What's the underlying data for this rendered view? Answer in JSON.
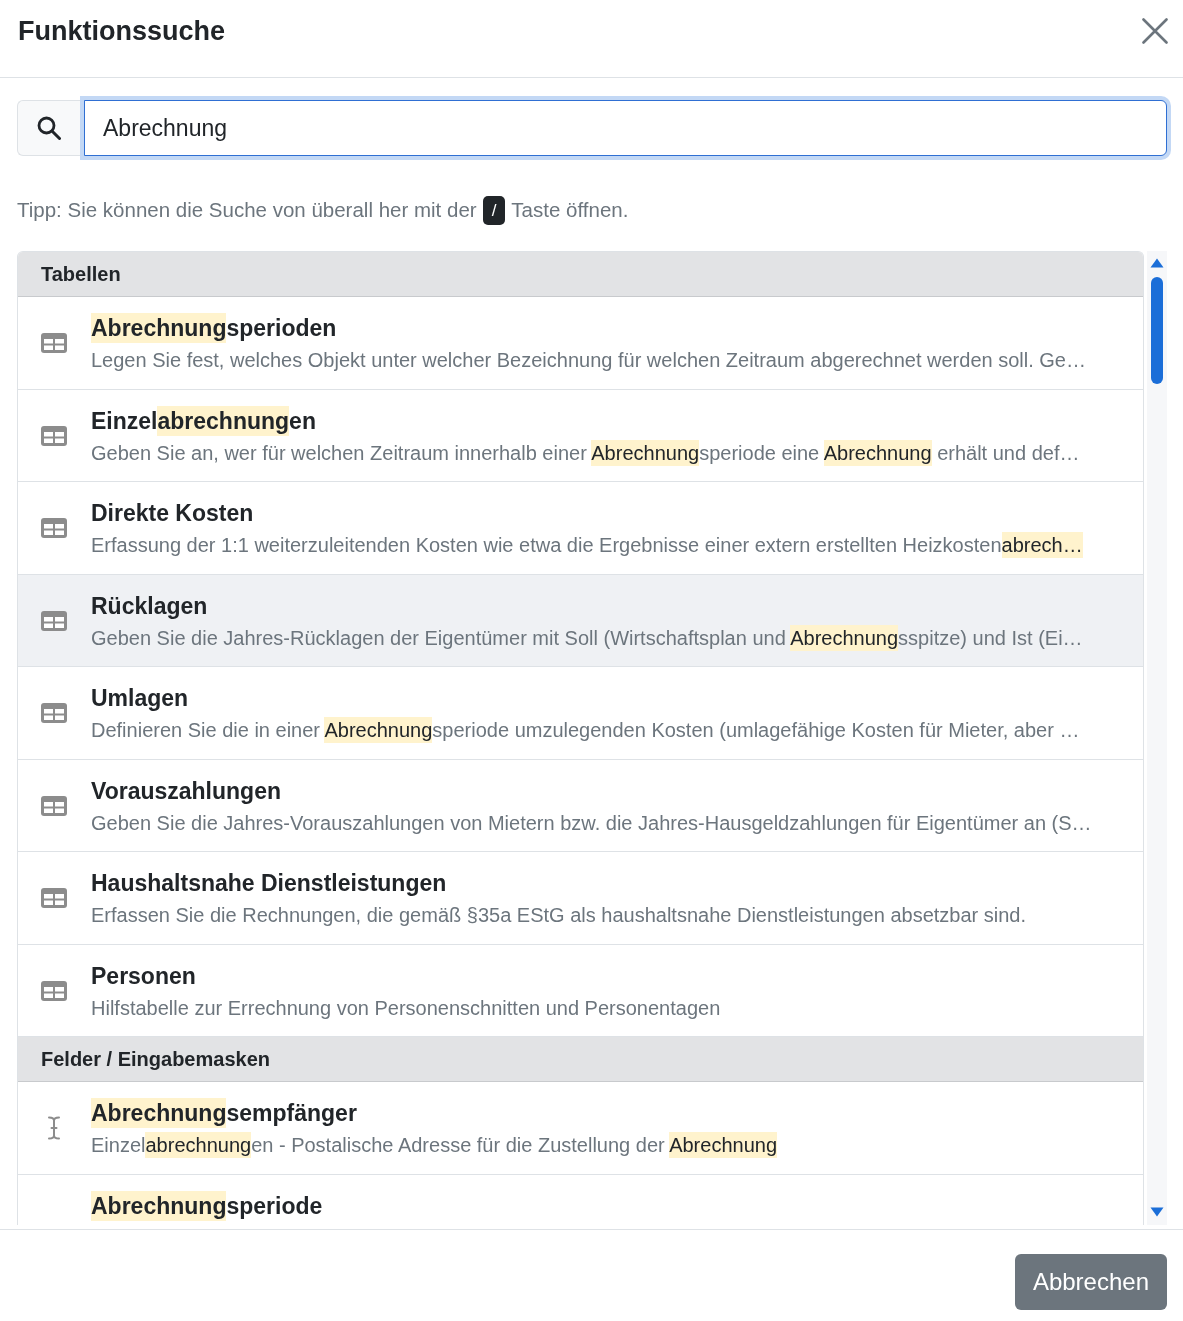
{
  "dialog": {
    "title": "Funktionssuche"
  },
  "search": {
    "value": "Abrechnung",
    "focused": true
  },
  "tip": {
    "before": "Tipp: Sie können die Suche von überall her mit der",
    "key": "/",
    "after": "Taste öffnen."
  },
  "groups": [
    {
      "label": "Tabellen",
      "items": [
        {
          "kind": "table",
          "selected": false,
          "title": [
            {
              "text": "Abrechnung",
              "highlight": true
            },
            {
              "text": "sperioden",
              "highlight": false
            }
          ],
          "description": [
            {
              "text": "Legen Sie fest, welches Objekt unter welcher Bezeichnung für welchen Zeitraum abgerechnet werden soll. Ge…",
              "highlight": false
            }
          ]
        },
        {
          "kind": "table",
          "selected": false,
          "title": [
            {
              "text": "Einzel",
              "highlight": false
            },
            {
              "text": "abrechnung",
              "highlight": true
            },
            {
              "text": "en",
              "highlight": false
            }
          ],
          "description": [
            {
              "text": "Geben Sie an, wer für welchen Zeitraum innerhalb einer ",
              "highlight": false
            },
            {
              "text": "Abrechnung",
              "highlight": true
            },
            {
              "text": "speriode eine ",
              "highlight": false
            },
            {
              "text": "Abrechnung",
              "highlight": true
            },
            {
              "text": " erhält und def…",
              "highlight": false
            }
          ]
        },
        {
          "kind": "table",
          "selected": false,
          "title": [
            {
              "text": "Direkte Kosten",
              "highlight": false
            }
          ],
          "description": [
            {
              "text": "Erfassung der 1:1 weiterzuleitenden Kosten wie etwa die Ergebnisse einer extern erstellten Heizkosten",
              "highlight": false
            },
            {
              "text": "abrech…",
              "highlight": true
            }
          ]
        },
        {
          "kind": "table",
          "selected": true,
          "title": [
            {
              "text": "Rücklagen",
              "highlight": false
            }
          ],
          "description": [
            {
              "text": "Geben Sie die Jahres-Rücklagen der Eigentümer mit Soll (Wirtschaftsplan und ",
              "highlight": false
            },
            {
              "text": "Abrechnung",
              "highlight": true
            },
            {
              "text": "sspitze) und Ist (Ei…",
              "highlight": false
            }
          ]
        },
        {
          "kind": "table",
          "selected": false,
          "title": [
            {
              "text": "Umlagen",
              "highlight": false
            }
          ],
          "description": [
            {
              "text": "Definieren Sie die in einer ",
              "highlight": false
            },
            {
              "text": "Abrechnung",
              "highlight": true
            },
            {
              "text": "speriode umzulegenden Kosten (umlagefähige Kosten für Mieter, aber …",
              "highlight": false
            }
          ]
        },
        {
          "kind": "table",
          "selected": false,
          "title": [
            {
              "text": "Vorauszahlungen",
              "highlight": false
            }
          ],
          "description": [
            {
              "text": "Geben Sie die Jahres-Vorauszahlungen von Mietern bzw. die Jahres-Hausgeldzahlungen für Eigentümer an (S…",
              "highlight": false
            }
          ]
        },
        {
          "kind": "table",
          "selected": false,
          "title": [
            {
              "text": "Haushaltsnahe Dienstleistungen",
              "highlight": false
            }
          ],
          "description": [
            {
              "text": "Erfassen Sie die Rechnungen, die gemäß §35a EStG als haushaltsnahe Dienstleistungen absetzbar sind.",
              "highlight": false
            }
          ]
        },
        {
          "kind": "table",
          "selected": false,
          "title": [
            {
              "text": "Personen",
              "highlight": false
            }
          ],
          "description": [
            {
              "text": "Hilfstabelle zur Errechnung von Personenschnitten und Personentagen",
              "highlight": false
            }
          ]
        }
      ]
    },
    {
      "label": "Felder / Eingabemasken",
      "items": [
        {
          "kind": "field",
          "selected": false,
          "title": [
            {
              "text": "Abrechnung",
              "highlight": true
            },
            {
              "text": "sempfänger",
              "highlight": false
            }
          ],
          "description": [
            {
              "text": "Einzel",
              "highlight": false
            },
            {
              "text": "abrechnung",
              "highlight": true
            },
            {
              "text": "en - Postalische Adresse für die Zustellung der ",
              "highlight": false
            },
            {
              "text": "Abrechnung",
              "highlight": true
            }
          ]
        },
        {
          "selected": false,
          "title": [
            {
              "text": "Abrechnung",
              "highlight": true
            },
            {
              "text": "speriode",
              "highlight": false
            }
          ]
        }
      ]
    }
  ],
  "footer": {
    "buttons": [
      "Abbrechen"
    ]
  }
}
